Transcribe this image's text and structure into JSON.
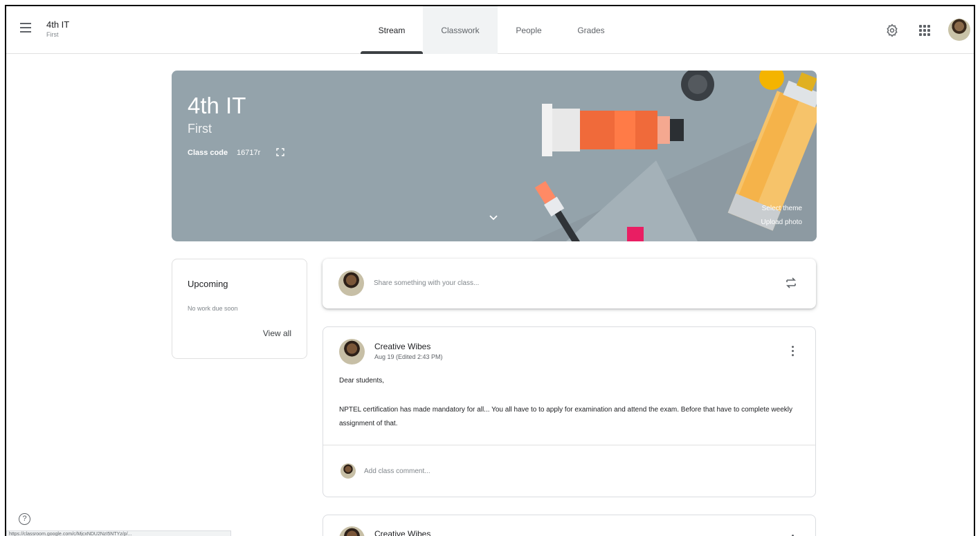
{
  "header": {
    "class_name": "4th IT",
    "class_section": "First",
    "tabs": [
      {
        "label": "Stream"
      },
      {
        "label": "Classwork"
      },
      {
        "label": "People"
      },
      {
        "label": "Grades"
      }
    ],
    "icons": [
      "menu-icon",
      "settings-icon",
      "apps-icon"
    ]
  },
  "banner": {
    "title": "4th IT",
    "section": "First",
    "class_code_label": "Class code",
    "class_code_value": "16717r",
    "select_theme": "Select theme",
    "upload_photo": "Upload photo",
    "background_color": "#94a3ab"
  },
  "upcoming": {
    "title": "Upcoming",
    "subtitle": "No work due soon",
    "view_all": "View all"
  },
  "share": {
    "placeholder": "Share something with your class..."
  },
  "posts": [
    {
      "author": "Creative Wibes",
      "date": "Aug 19 (Edited 2:43 PM)",
      "greeting": "Dear students,",
      "body": "NPTEL certification has made mandatory for all... You all have to to apply for examination and attend the exam. Before that have to complete weekly assignment of that.",
      "comment_placeholder": "Add class comment..."
    },
    {
      "author": "Creative Wibes"
    }
  ],
  "footer": {
    "help": "?",
    "status_url": "https://classroom.google.com/c/MjcxNDU2NzI5NTYz/p/..."
  },
  "colors": {
    "accent": "#3c4043",
    "tab_active_bg": "#f1f3f4",
    "banner_bg": "#94a3ab"
  }
}
